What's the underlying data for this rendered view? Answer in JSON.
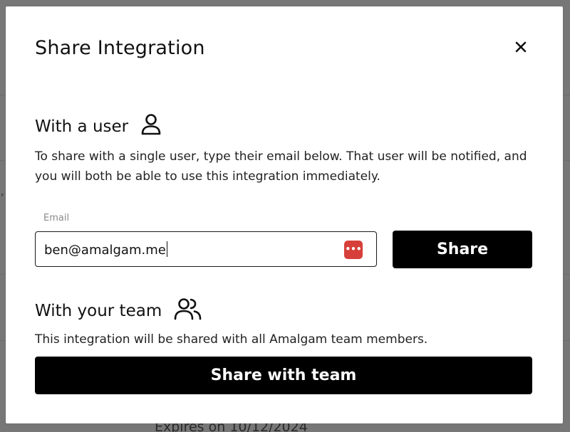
{
  "background": {
    "partial_text": "Expires on 10/12/2024",
    "partial_char": ","
  },
  "modal": {
    "title": "Share Integration",
    "close_label": "×"
  },
  "user_section": {
    "heading": "With a user",
    "icon": "user-icon",
    "description": "To share with a single user, type their email below. That user will be notified, and you will both be able to use this integration immediately.",
    "email_label": "Email",
    "email_value": "ben@amalgam.me",
    "password_manager_icon": "password-manager-icon",
    "share_button": "Share"
  },
  "team_section": {
    "heading": "With your team",
    "icon": "users-icon",
    "description": "This integration will be shared with all Amalgam team members.",
    "share_button": "Share with team"
  },
  "colors": {
    "button_bg": "#000000",
    "button_text": "#ffffff",
    "password_icon_bg": "#d7403a"
  }
}
